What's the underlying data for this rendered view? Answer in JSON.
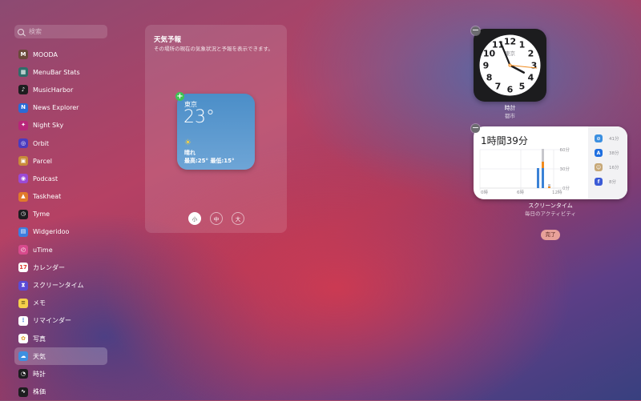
{
  "sidebar": {
    "search_placeholder": "検索",
    "items": [
      {
        "label": "MOODA",
        "icon": "mooda-icon",
        "color": "#6b4a3a"
      },
      {
        "label": "MenuBar Stats",
        "icon": "menubar-stats-icon",
        "color": "#2f6d6a"
      },
      {
        "label": "MusicHarbor",
        "icon": "musicharbor-icon",
        "color": "#1d1d1f"
      },
      {
        "label": "News Explorer",
        "icon": "news-explorer-icon",
        "color": "#2a6bd6"
      },
      {
        "label": "Night Sky",
        "icon": "night-sky-icon",
        "color": "#b8267a"
      },
      {
        "label": "Orbit",
        "icon": "orbit-icon",
        "color": "#4b3bbf"
      },
      {
        "label": "Parcel",
        "icon": "parcel-icon",
        "color": "#c98b3a"
      },
      {
        "label": "Podcast",
        "icon": "podcast-icon",
        "color": "#9b4ad6"
      },
      {
        "label": "Taskheat",
        "icon": "taskheat-icon",
        "color": "#e07a2b"
      },
      {
        "label": "Tyme",
        "icon": "tyme-icon",
        "color": "#1d1d1f"
      },
      {
        "label": "Widgeridoo",
        "icon": "widgeridoo-icon",
        "color": "#3c7de0"
      },
      {
        "label": "uTime",
        "icon": "utime-icon",
        "color": "#d84a8c"
      },
      {
        "label": "カレンダー",
        "icon": "calendar-icon",
        "color": "#ffffff"
      },
      {
        "label": "スクリーンタイム",
        "icon": "screen-time-icon",
        "color": "#5b4bd6"
      },
      {
        "label": "メモ",
        "icon": "notes-icon",
        "color": "#f5d04a"
      },
      {
        "label": "リマインダー",
        "icon": "reminders-icon",
        "color": "#ffffff"
      },
      {
        "label": "写真",
        "icon": "photos-icon",
        "color": "#ffffff"
      },
      {
        "label": "天気",
        "icon": "weather-icon",
        "color": "#3d8fe0",
        "selected": true
      },
      {
        "label": "時計",
        "icon": "clock-icon",
        "color": "#1d1d1f"
      },
      {
        "label": "株価",
        "icon": "stocks-icon",
        "color": "#1d1d1f"
      }
    ]
  },
  "panel": {
    "title": "天気予報",
    "description": "その場所の現在の気象状況と予報を表示できます。",
    "widget": {
      "city": "東京",
      "temp": "23°",
      "condition": "晴れ",
      "range": "最高:25° 最低:15°",
      "sun_icon": "sun-icon"
    },
    "sizes": [
      "小",
      "中",
      "大"
    ]
  },
  "clock": {
    "city": "東京",
    "caption": "時計",
    "subcaption": "都市",
    "numbers": [
      "12",
      "1",
      "2",
      "3",
      "4",
      "5",
      "6",
      "7",
      "8",
      "9",
      "10",
      "11"
    ],
    "time": {
      "hour": 15,
      "minute": 56,
      "second": 16
    }
  },
  "screen_time": {
    "total": "1時間39分",
    "caption": "スクリーンタイム",
    "subcaption": "毎日のアクティビティ",
    "y_labels": [
      "60分",
      "30分",
      "0分"
    ],
    "x_labels": [
      "0時",
      "6時",
      "12時"
    ],
    "apps": [
      {
        "icon": "safari-icon",
        "time": "41分",
        "color": "#3b8fe0"
      },
      {
        "icon": "app-store-icon",
        "time": "38分",
        "color": "#1f6fe0"
      },
      {
        "icon": "finder-icon",
        "time": "16分",
        "color": "#c7a877"
      },
      {
        "icon": "facebook-icon",
        "time": "8分",
        "color": "#3b5bd6"
      }
    ]
  },
  "done_label": "完了",
  "colors": {
    "accent_green": "#3fc455",
    "done_button": "#e8a199",
    "bar_blue": "#3b82d6",
    "bar_gray": "#c7c7cc"
  }
}
